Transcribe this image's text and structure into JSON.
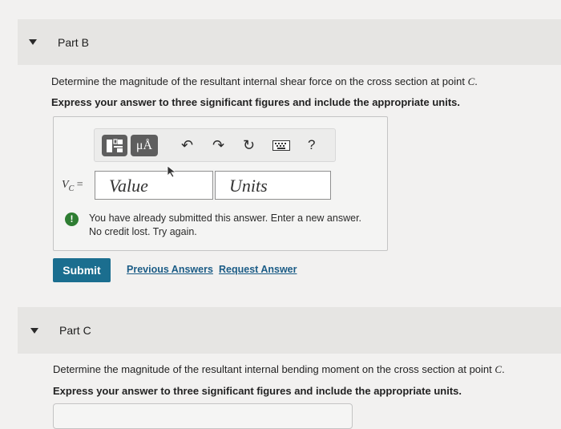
{
  "part_b": {
    "title": "Part B",
    "question_prefix": "Determine the magnitude of the resultant internal shear force on the cross section at point ",
    "question_point": "C",
    "question_suffix": ".",
    "instruction": "Express your answer to three significant figures and include the appropriate units.",
    "answer": {
      "label": "VC =",
      "value_placeholder": "Value",
      "units_placeholder": "Units",
      "toolbar": {
        "template_icon": "templates-icon",
        "units_icon": "units-icon",
        "units_text": "μÅ",
        "undo_icon": "undo-icon",
        "redo_icon": "redo-icon",
        "reset_icon": "reset-icon",
        "keyboard_icon": "keyboard-icon",
        "help_text": "?"
      }
    },
    "feedback": {
      "line1": "You have already submitted this answer. Enter a new answer.",
      "line2": "No credit lost. Try again."
    },
    "submit_label": "Submit",
    "previous_answers_label": "Previous Answers",
    "request_answer_label": "Request Answer"
  },
  "part_c": {
    "title": "Part C",
    "question_prefix": "Determine the magnitude of the resultant internal bending moment on the cross section at point ",
    "question_point": "C",
    "question_suffix": ".",
    "instruction": "Express your answer to three significant figures and include the appropriate units."
  },
  "colors": {
    "submit_bg": "#1b6e8f",
    "link": "#1b5c86",
    "feedback_icon": "#2e7d32"
  }
}
